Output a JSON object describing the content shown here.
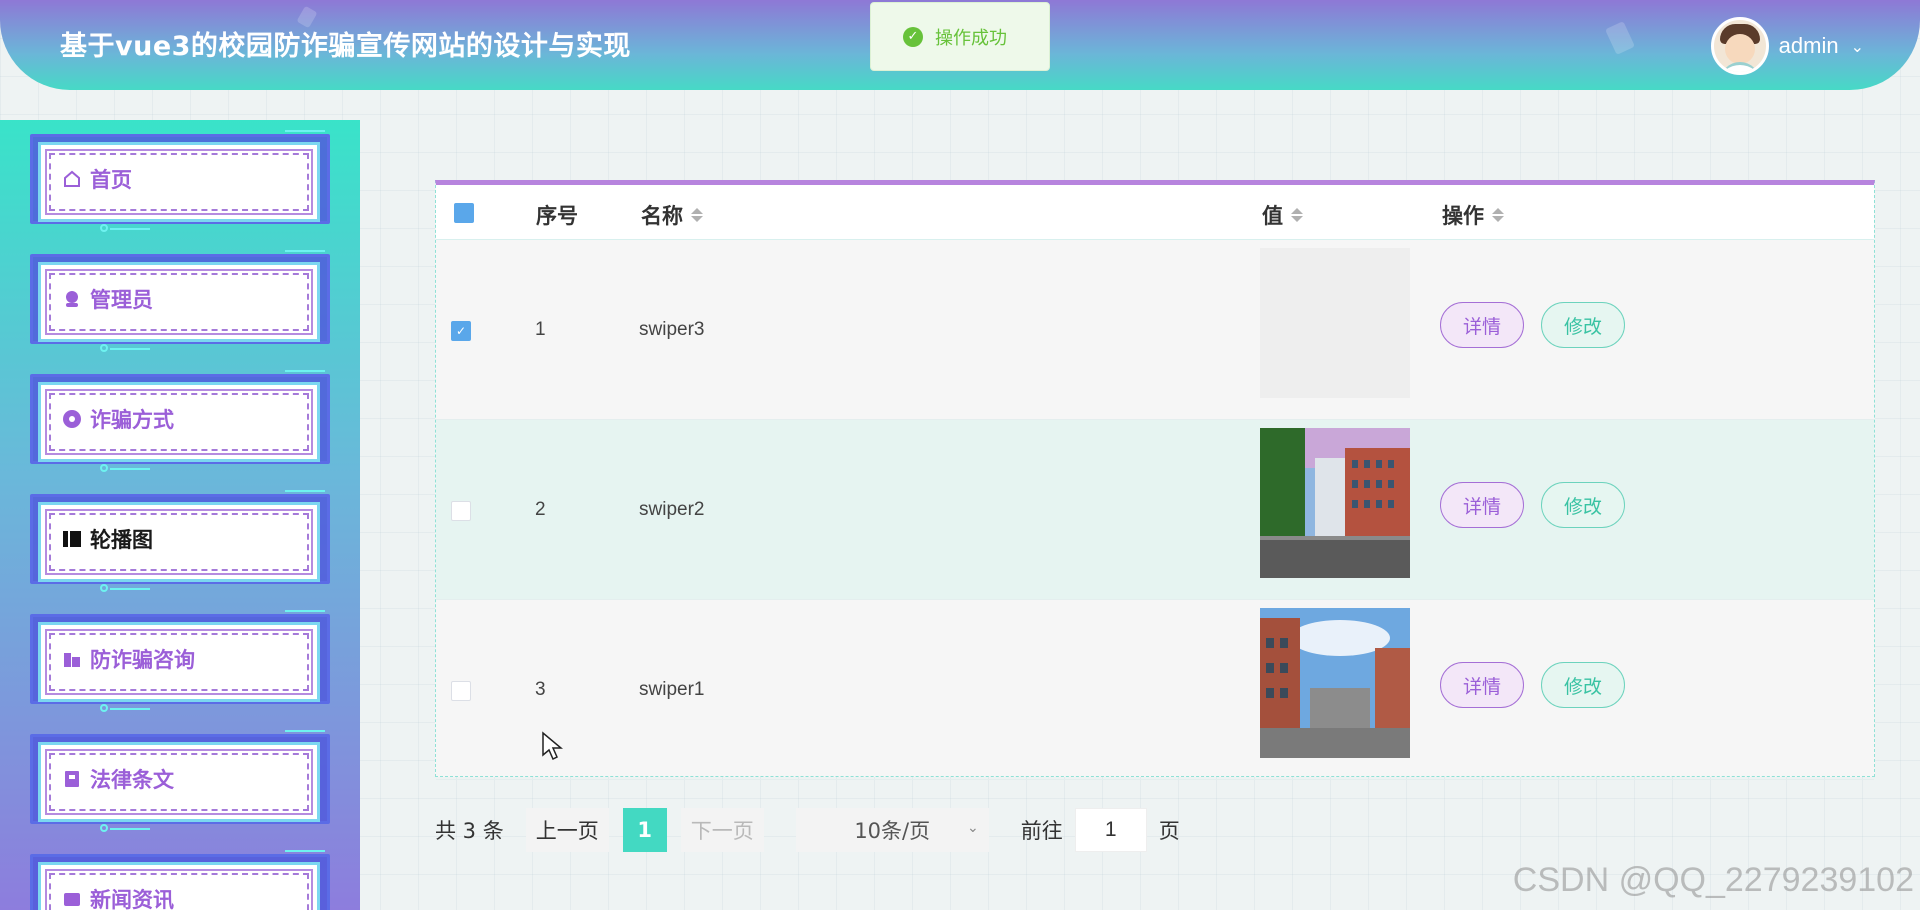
{
  "header": {
    "title": "基于vue3的校园防诈骗宣传网站的设计与实现",
    "username": "admin"
  },
  "toast": {
    "message": "操作成功",
    "icon": "check-circle-icon"
  },
  "sidebar": {
    "items": [
      {
        "label": "首页",
        "icon": "home-icon",
        "active": false
      },
      {
        "label": "管理员",
        "icon": "user-icon",
        "active": false
      },
      {
        "label": "诈骗方式",
        "icon": "circle-icon",
        "active": false
      },
      {
        "label": "轮播图",
        "icon": "film-icon",
        "active": true
      },
      {
        "label": "防诈骗咨询",
        "icon": "building-icon",
        "active": false
      },
      {
        "label": "法律条文",
        "icon": "book-icon",
        "active": false
      },
      {
        "label": "新闻资讯",
        "icon": "news-icon",
        "active": false
      }
    ]
  },
  "table": {
    "columns": {
      "index": "序号",
      "name": "名称",
      "value": "值",
      "action": "操作"
    },
    "rows": [
      {
        "index": "1",
        "name": "swiper3",
        "checked": true,
        "image": "empty"
      },
      {
        "index": "2",
        "name": "swiper2",
        "checked": false,
        "image": "campus-building-1"
      },
      {
        "index": "3",
        "name": "swiper1",
        "checked": false,
        "image": "campus-building-2"
      }
    ],
    "detail_label": "详情",
    "edit_label": "修改"
  },
  "pagination": {
    "total": "共 3 条",
    "prev": "上一页",
    "current": "1",
    "next": "下一页",
    "page_size": "10条/页",
    "goto": "前往",
    "jump_value": "1",
    "page_word": "页"
  },
  "watermark": "CSDN @QQ_2279239102",
  "colors": {
    "accent": "#43d9c2",
    "purple": "#9b5fd8",
    "toast_green": "#67c23a"
  }
}
